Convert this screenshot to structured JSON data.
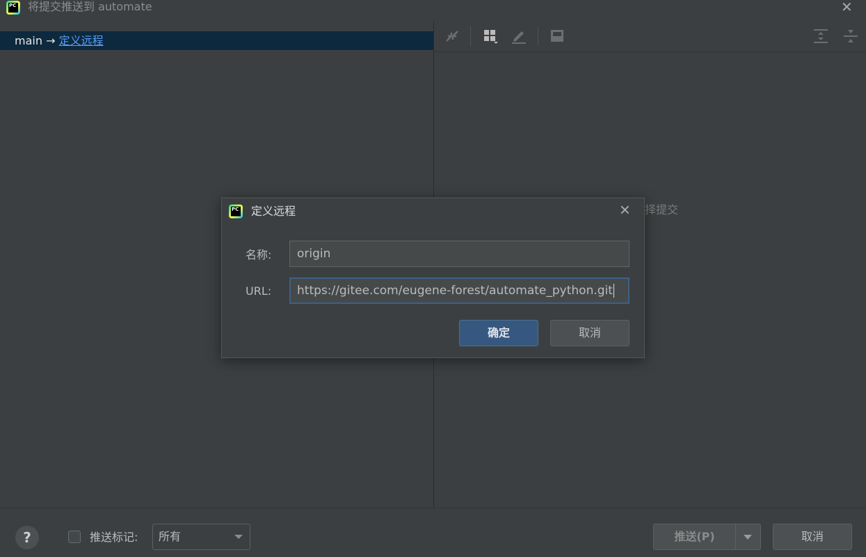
{
  "window": {
    "title": "将提交推送到 automate",
    "close_icon": "close-icon"
  },
  "left_panel": {
    "branch": "main",
    "arrow": "→",
    "remote_link": "定义远程"
  },
  "right_panel": {
    "toolbar_icons": [
      "merge-arrows-icon",
      "group-by-icon",
      "edit-icon",
      "preview-panel-icon",
      "expand-all-icon",
      "collapse-all-icon"
    ],
    "empty_text": "择提交"
  },
  "bottom_bar": {
    "help_label": "?",
    "push_tags_label": "推送标记:",
    "push_tags_selected": "所有",
    "push_button": "推送(P)",
    "cancel_button": "取消"
  },
  "dialog": {
    "title": "定义远程",
    "name_label": "名称:",
    "name_value": "origin",
    "url_label": "URL:",
    "url_value": "https://gitee.com/eugene-forest/automate_python.git",
    "ok_button": "确定",
    "cancel_button": "取消"
  },
  "colors": {
    "background": "#3c3f41",
    "selection": "#0d293e",
    "link": "#589df6",
    "primary_button": "#365880",
    "focus_border": "#3d6185"
  }
}
